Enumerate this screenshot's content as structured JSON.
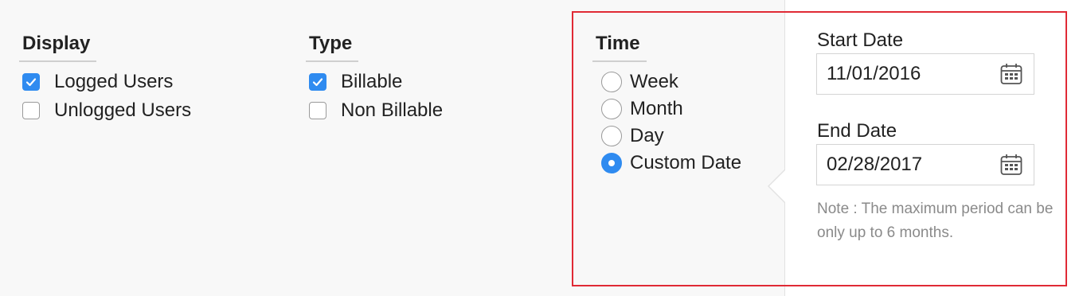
{
  "display": {
    "heading": "Display",
    "options": [
      {
        "label": "Logged Users",
        "checked": true
      },
      {
        "label": "Unlogged Users",
        "checked": false
      }
    ]
  },
  "type": {
    "heading": "Type",
    "options": [
      {
        "label": "Billable",
        "checked": true
      },
      {
        "label": "Non Billable",
        "checked": false
      }
    ]
  },
  "time": {
    "heading": "Time",
    "options": [
      {
        "label": "Week",
        "selected": false
      },
      {
        "label": "Month",
        "selected": false
      },
      {
        "label": "Day",
        "selected": false
      },
      {
        "label": "Custom Date",
        "selected": true
      }
    ]
  },
  "custom_date": {
    "start_label": "Start Date",
    "start_value": "11/01/2016",
    "end_label": "End Date",
    "end_value": "02/28/2017",
    "note": "Note : The maximum period can be only up to 6 months.",
    "icon": "calendar-icon"
  },
  "colors": {
    "accent": "#2f8bf0",
    "highlight_border": "#e02a35",
    "note_text": "#8a8a8a"
  }
}
